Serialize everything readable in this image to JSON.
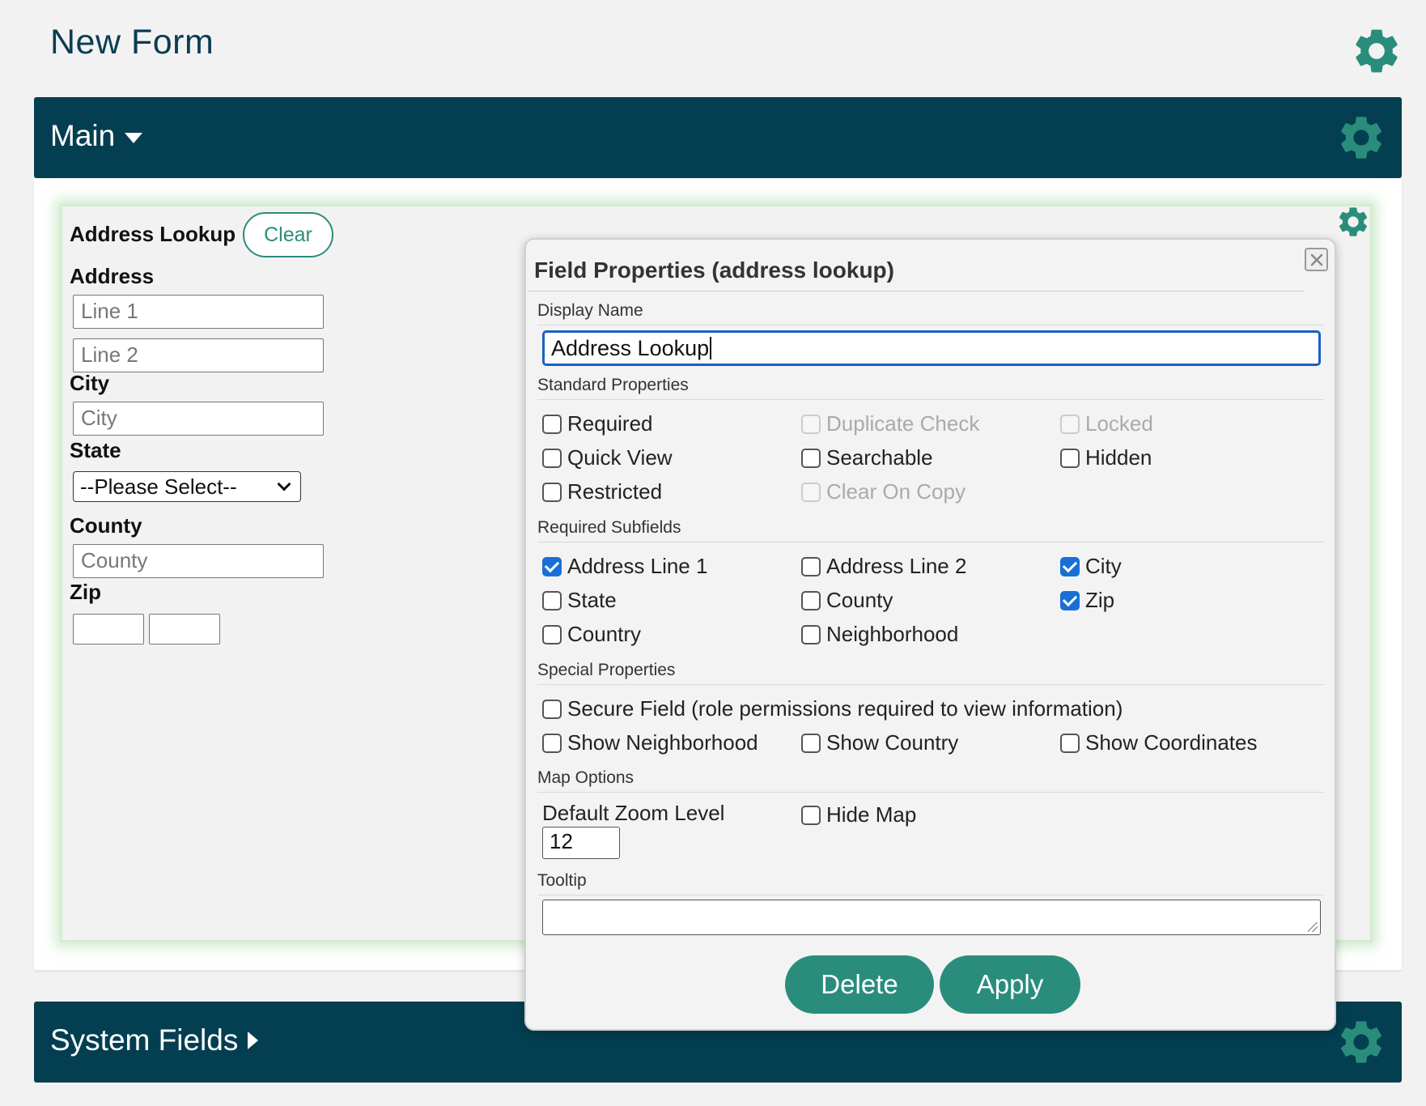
{
  "page": {
    "title": "New Form"
  },
  "sections": {
    "main": {
      "title": "Main"
    },
    "system_fields": {
      "title": "System Fields"
    }
  },
  "field": {
    "label": "Address Lookup",
    "clear_label": "Clear",
    "address_label": "Address",
    "line1_placeholder": "Line 1",
    "line2_placeholder": "Line 2",
    "city_label": "City",
    "city_placeholder": "City",
    "state_label": "State",
    "state_selected": "--Please Select--",
    "county_label": "County",
    "county_placeholder": "County",
    "zip_label": "Zip"
  },
  "dialog": {
    "title": "Field Properties (address lookup)",
    "display_name": {
      "label": "Display Name",
      "value": "Address Lookup"
    },
    "standard": {
      "heading": "Standard Properties",
      "items": [
        {
          "label": "Required",
          "checked": false,
          "disabled": false
        },
        {
          "label": "Duplicate Check",
          "checked": false,
          "disabled": true
        },
        {
          "label": "Locked",
          "checked": false,
          "disabled": true
        },
        {
          "label": "Quick View",
          "checked": false,
          "disabled": false
        },
        {
          "label": "Searchable",
          "checked": false,
          "disabled": false
        },
        {
          "label": "Hidden",
          "checked": false,
          "disabled": false
        },
        {
          "label": "Restricted",
          "checked": false,
          "disabled": false
        },
        {
          "label": "Clear On Copy",
          "checked": false,
          "disabled": true
        }
      ]
    },
    "required_subfields": {
      "heading": "Required Subfields",
      "items": [
        {
          "label": "Address Line 1",
          "checked": true
        },
        {
          "label": "Address Line 2",
          "checked": false
        },
        {
          "label": "City",
          "checked": true
        },
        {
          "label": "State",
          "checked": false
        },
        {
          "label": "County",
          "checked": false
        },
        {
          "label": "Zip",
          "checked": true
        },
        {
          "label": "Country",
          "checked": false
        },
        {
          "label": "Neighborhood",
          "checked": false
        }
      ]
    },
    "special": {
      "heading": "Special Properties",
      "items": [
        {
          "label": "Secure Field (role permissions required to view information)",
          "checked": false
        },
        {
          "label": "Show Neighborhood",
          "checked": false
        },
        {
          "label": "Show Country",
          "checked": false
        },
        {
          "label": "Show Coordinates",
          "checked": false
        }
      ]
    },
    "map": {
      "heading": "Map Options",
      "zoom_label": "Default Zoom Level",
      "zoom_value": "12",
      "hide_map": {
        "label": "Hide Map",
        "checked": false
      }
    },
    "tooltip": {
      "heading": "Tooltip",
      "value": ""
    },
    "buttons": {
      "delete": "Delete",
      "apply": "Apply"
    }
  },
  "icons": {
    "gear": "gear-icon",
    "close": "close-icon",
    "dropdown": "caret-down-icon",
    "expand": "caret-right-icon"
  },
  "colors": {
    "header_bg": "#043f51",
    "accent": "#2a8d7b",
    "focus_blue": "#1a5fc1",
    "check_blue": "#1a6fd6"
  }
}
